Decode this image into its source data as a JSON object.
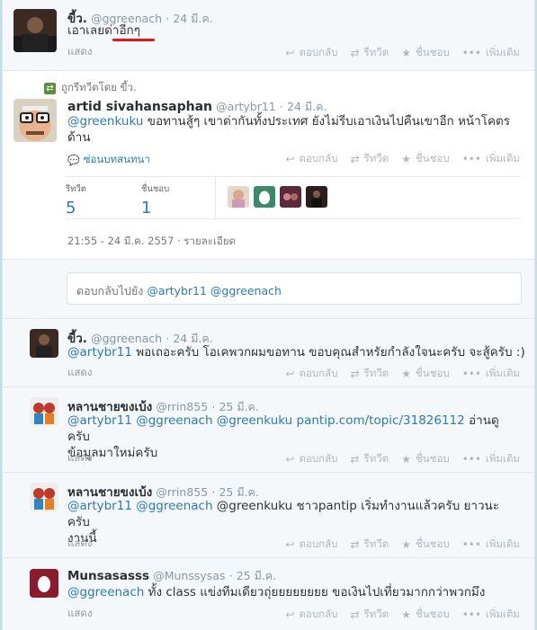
{
  "tweet1": {
    "name": "ขี้ว.",
    "handle": "@ggreenach",
    "sep": "·",
    "date": "24 มี.ค.",
    "text": "เอาเลยด่าอีกๆ",
    "show": "แสดง"
  },
  "main": {
    "retweeted_by": "ถูกรีทวีตโดย ขี้ว.",
    "name": "artid sivahansaphan",
    "handle": "@artybr11",
    "sep": "·",
    "date": "24 มี.ค.",
    "text_mention": "@greenkuku",
    "text_body_1": " ขอทานสู้ๆ เขาด่ากันทั้งประเทศ ยังไม่รีบเอาเงินไปคืนเขาอีก หน้าโคตร",
    "text_body_2": "ด้าน",
    "conversation": "ซ่อนบทสนทนา",
    "retweets_label": "รีทวีต",
    "retweets": "5",
    "favorites_label": "ชื่นชอบ",
    "favorites": "1",
    "timestamp": "21:55 - 24 มี.ค. 2557",
    "details": "รายละเอียด"
  },
  "actions": {
    "reply": "ตอบกลับ",
    "retweet": "รีทวีต",
    "favorite": "ชื่นชอบ",
    "more": "เพิ่มเติม"
  },
  "reply_box": {
    "prefix": "ตอบกลับไปยัง ",
    "mentions": "@artybr11 @ggreenach"
  },
  "replies": [
    {
      "name": "ขี้ว.",
      "handle": "@ggreenach",
      "date": "24 มี.ค.",
      "mentions": "@artybr11",
      "text": " พอเถอะครับ โอเคพวกผมขอทาน ขอบคุณสำหรัยกำลังใจนะครับ จะสู้ครับ :)",
      "text2": "",
      "show": "แสดง"
    },
    {
      "name": "หลานชายขงเบ้ง",
      "handle": "@rrin855",
      "date": "25 มี.ค.",
      "mentions": "@artybr11 @ggreenach @greenkuku pantip.com/topic/31826112",
      "text": " อ่านดูครับ",
      "text2": "ข้อมูลมาใหม่ครับ",
      "show": "แสดง"
    },
    {
      "name": "หลานชายขงเบ้ง",
      "handle": "@rrin855",
      "date": "25 มี.ค.",
      "mentions": "@artybr11 @ggreenach",
      "text": " @greenkuku  ชาวpantip เริ่มทำงานแล้วครับ ยาวนะครับ",
      "text2": "งานนี้",
      "show": "แสดง"
    },
    {
      "name": "Munsasasss",
      "handle": "@Munssysas",
      "date": "25 มี.ค.",
      "mentions": "@ggreenach",
      "text": " ทั้ง class แข่งทีมเดียวถุ่ยยยยยยยย ขอเงินไปเที่ยวมากกว่าพวกมึง",
      "text2": "",
      "show": "แสดง"
    }
  ],
  "colors": {
    "link": "#2b7bb9",
    "retweet_green": "#5c913b",
    "underline_red": "#e0161d"
  }
}
